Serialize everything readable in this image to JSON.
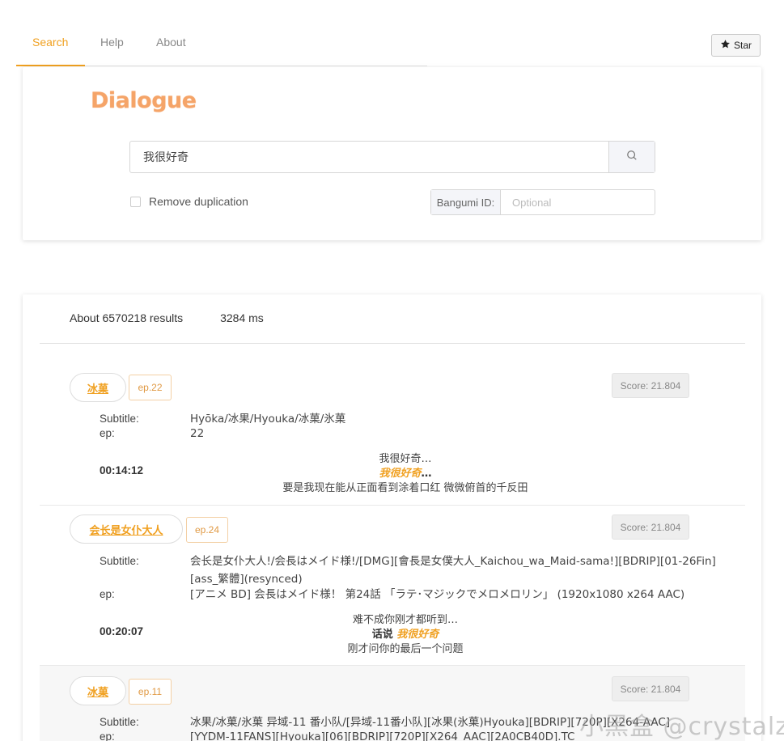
{
  "tabs": [
    {
      "label": "Search",
      "active": true
    },
    {
      "label": "Help",
      "active": false
    },
    {
      "label": "About",
      "active": false
    }
  ],
  "star_button": {
    "label": "Star",
    "icon": "star-icon"
  },
  "search": {
    "logo": "Dialogue",
    "query": "我很好奇",
    "search_icon": "search-icon",
    "remove_duplication_label": "Remove duplication",
    "remove_duplication_checked": false,
    "bangumi_label": "Bangumi ID:",
    "bangumi_placeholder": "Optional"
  },
  "results": {
    "count_text": "About 6570218 results",
    "time_text": "3284 ms",
    "subtitle_label": "Subtitle:",
    "ep_label": "ep:",
    "items": [
      {
        "anime": "冰菓",
        "ep_badge": "ep.22",
        "score": "Score: 21.804",
        "subtitle": "Hyōka/冰果/Hyouka/冰菓/氷菓",
        "ep": "22",
        "time": "00:14:12",
        "before": "我很好奇…",
        "match_prefix": "",
        "match_keyword": "我很好奇",
        "match_suffix": "…",
        "after": "要是我现在能从正面看到涂着口红 微微俯首的千反田"
      },
      {
        "anime": "会长是女仆大人",
        "ep_badge": "ep.24",
        "score": "Score: 21.804",
        "subtitle": "会长是女仆大人!/会長はメイド様!/[DMG][會長是女僕大人_Kaichou_wa_Maid-sama!][BDRIP][01-26Fin][ass_繁體](resynced)",
        "ep": "[アニメ BD] 会長はメイド様！ 第24話 「ラテ･マジックでメロメロリン」 (1920x1080 x264 AAC)",
        "time": "00:20:07",
        "before": "难不成你刚才都听到…",
        "match_prefix": "话说 ",
        "match_keyword": "我很好奇",
        "match_suffix": "",
        "after": "刚才问你的最后一个问题"
      },
      {
        "anime": "冰菓",
        "ep_badge": "ep.11",
        "score": "Score: 21.804",
        "subtitle": "冰果/冰菓/氷菓 异域-11 番小队/[异域-11番小队][冰果(氷菓)Hyouka][BDRIP][720P][X264-AAC]",
        "ep": "[YYDM-11FANS][Hyouka][06][BDRIP][720P][X264_AAC][2A0CB40D].TC"
      }
    ]
  },
  "watermark": "小黑盒 @crystalz",
  "colors": {
    "accent": "#f0a020",
    "logo": "#f5a468"
  }
}
